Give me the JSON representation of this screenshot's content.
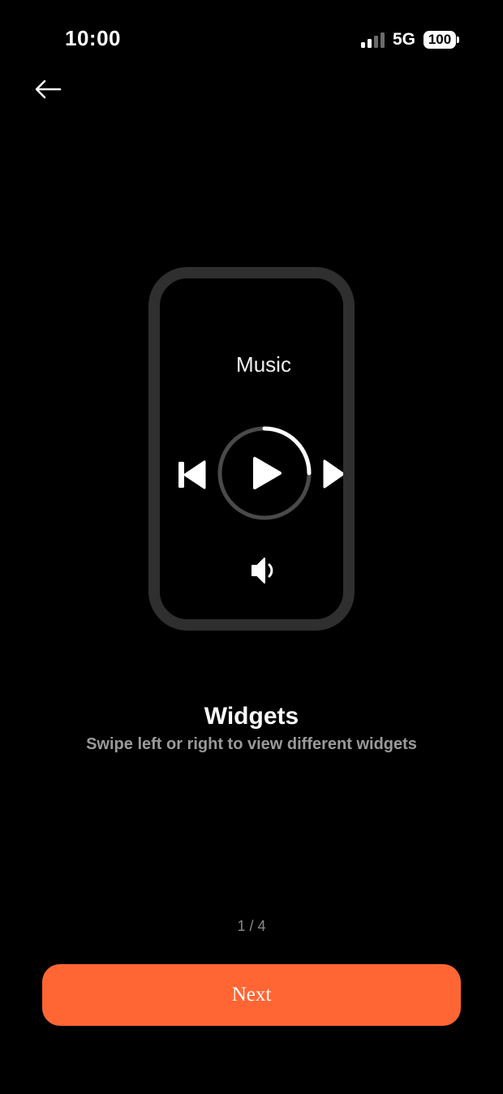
{
  "status_bar": {
    "time": "10:00",
    "network": "5G",
    "battery": "100",
    "signal_bars_active": 2,
    "signal_bars_total": 4
  },
  "nav": {
    "back_icon": "arrow-left-icon"
  },
  "illustration": {
    "widget_title": "Music",
    "icons": [
      "previous-track-icon",
      "play-icon",
      "next-track-icon",
      "volume-icon"
    ],
    "progress": 0.33
  },
  "content": {
    "title": "Widgets",
    "subtitle": "Swipe left or right to view different widgets"
  },
  "pager": {
    "text": "1 / 4"
  },
  "actions": {
    "next_label": "Next"
  },
  "colors": {
    "background": "#000000",
    "accent": "#ff6633",
    "device_frame": "#2f2f2f",
    "subtitle": "#9a9a9a"
  }
}
